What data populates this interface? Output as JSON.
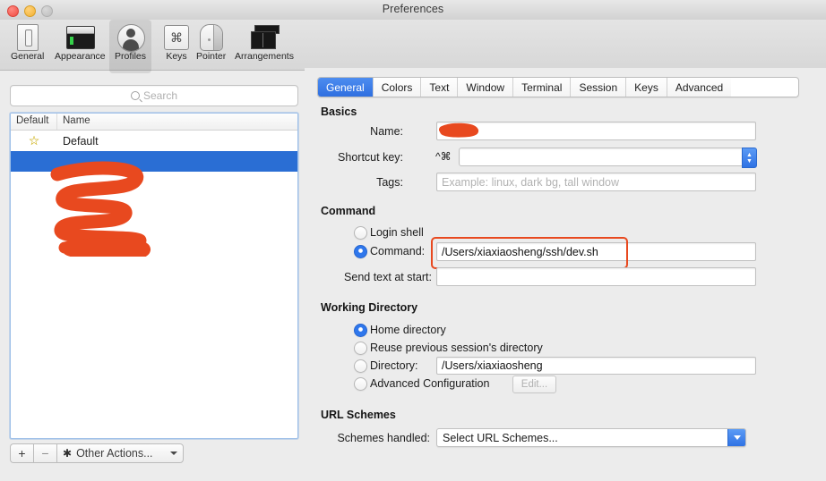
{
  "window": {
    "title": "Preferences",
    "traffic_lights": [
      "close-button",
      "minimize-button",
      "maximize-button"
    ]
  },
  "toolbar": {
    "items": [
      {
        "label": "General",
        "icon": "general-icon",
        "selected": false
      },
      {
        "label": "Appearance",
        "icon": "appearance-icon",
        "selected": false
      },
      {
        "label": "Profiles",
        "icon": "profiles-icon",
        "selected": true
      },
      {
        "label": "Keys",
        "icon": "keys-icon",
        "selected": false
      },
      {
        "label": "Pointer",
        "icon": "pointer-icon",
        "selected": false
      },
      {
        "label": "Arrangements",
        "icon": "arrangements-icon",
        "selected": false
      }
    ]
  },
  "sidebar": {
    "search": {
      "placeholder": "Search",
      "value": "",
      "icon": "search-icon"
    },
    "table": {
      "columns": [
        "Default",
        "Name"
      ],
      "rows": [
        {
          "default_star": "☆",
          "name": "Default",
          "selected": false,
          "redacted": false
        },
        {
          "default_star": "",
          "name": "",
          "selected": true,
          "redacted": true
        },
        {
          "default_star": "",
          "name": "",
          "selected": false,
          "redacted": true
        },
        {
          "default_star": "",
          "name": "",
          "selected": false,
          "redacted": true
        },
        {
          "default_star": "",
          "name": "",
          "selected": false,
          "redacted": true
        }
      ]
    },
    "actions": {
      "add_label": "+",
      "remove_label": "−",
      "other_actions_label": "Other Actions...",
      "gear_icon": "gear-icon",
      "chevron_icon": "chevron-down-icon"
    }
  },
  "tabs": [
    {
      "label": "General",
      "active": true
    },
    {
      "label": "Colors",
      "active": false
    },
    {
      "label": "Text",
      "active": false
    },
    {
      "label": "Window",
      "active": false
    },
    {
      "label": "Terminal",
      "active": false
    },
    {
      "label": "Session",
      "active": false
    },
    {
      "label": "Keys",
      "active": false
    },
    {
      "label": "Advanced",
      "active": false
    }
  ],
  "general_tab": {
    "basics": {
      "title": "Basics",
      "name": {
        "label": "Name:",
        "value": "",
        "redacted": true
      },
      "shortcut_key": {
        "label": "Shortcut key:",
        "modifiers": "^⌘",
        "value": "",
        "stepper": "stepper-control"
      },
      "tags": {
        "label": "Tags:",
        "value": "",
        "placeholder": "Example: linux, dark bg, tall window"
      }
    },
    "command": {
      "title": "Command",
      "login_shell": {
        "label": "Login shell",
        "selected": false
      },
      "command": {
        "label": "Command:",
        "selected": true,
        "value": "/Users/xiaxiaosheng/ssh/dev.sh",
        "highlighted": true
      },
      "send_text": {
        "label": "Send text at start:",
        "value": ""
      }
    },
    "working_directory": {
      "title": "Working Directory",
      "options": [
        {
          "label": "Home directory",
          "selected": true
        },
        {
          "label": "Reuse previous session's directory",
          "selected": false
        },
        {
          "label": "Directory:",
          "selected": false,
          "value": "/Users/xiaxiaosheng"
        },
        {
          "label": "Advanced Configuration",
          "selected": false,
          "button_label": "Edit...",
          "button_disabled": true
        }
      ]
    },
    "url_schemes": {
      "title": "URL Schemes",
      "schemes_handled": {
        "label": "Schemes handled:",
        "value": "Select URL Schemes...",
        "icon": "chevron-down-icon"
      }
    }
  },
  "colors": {
    "accent_blue": "#2f72e4",
    "selection_blue": "#2a6ed4",
    "redaction_orange": "#e8491f",
    "window_bg": "#ececec",
    "star_yellow": "#e3c427"
  }
}
